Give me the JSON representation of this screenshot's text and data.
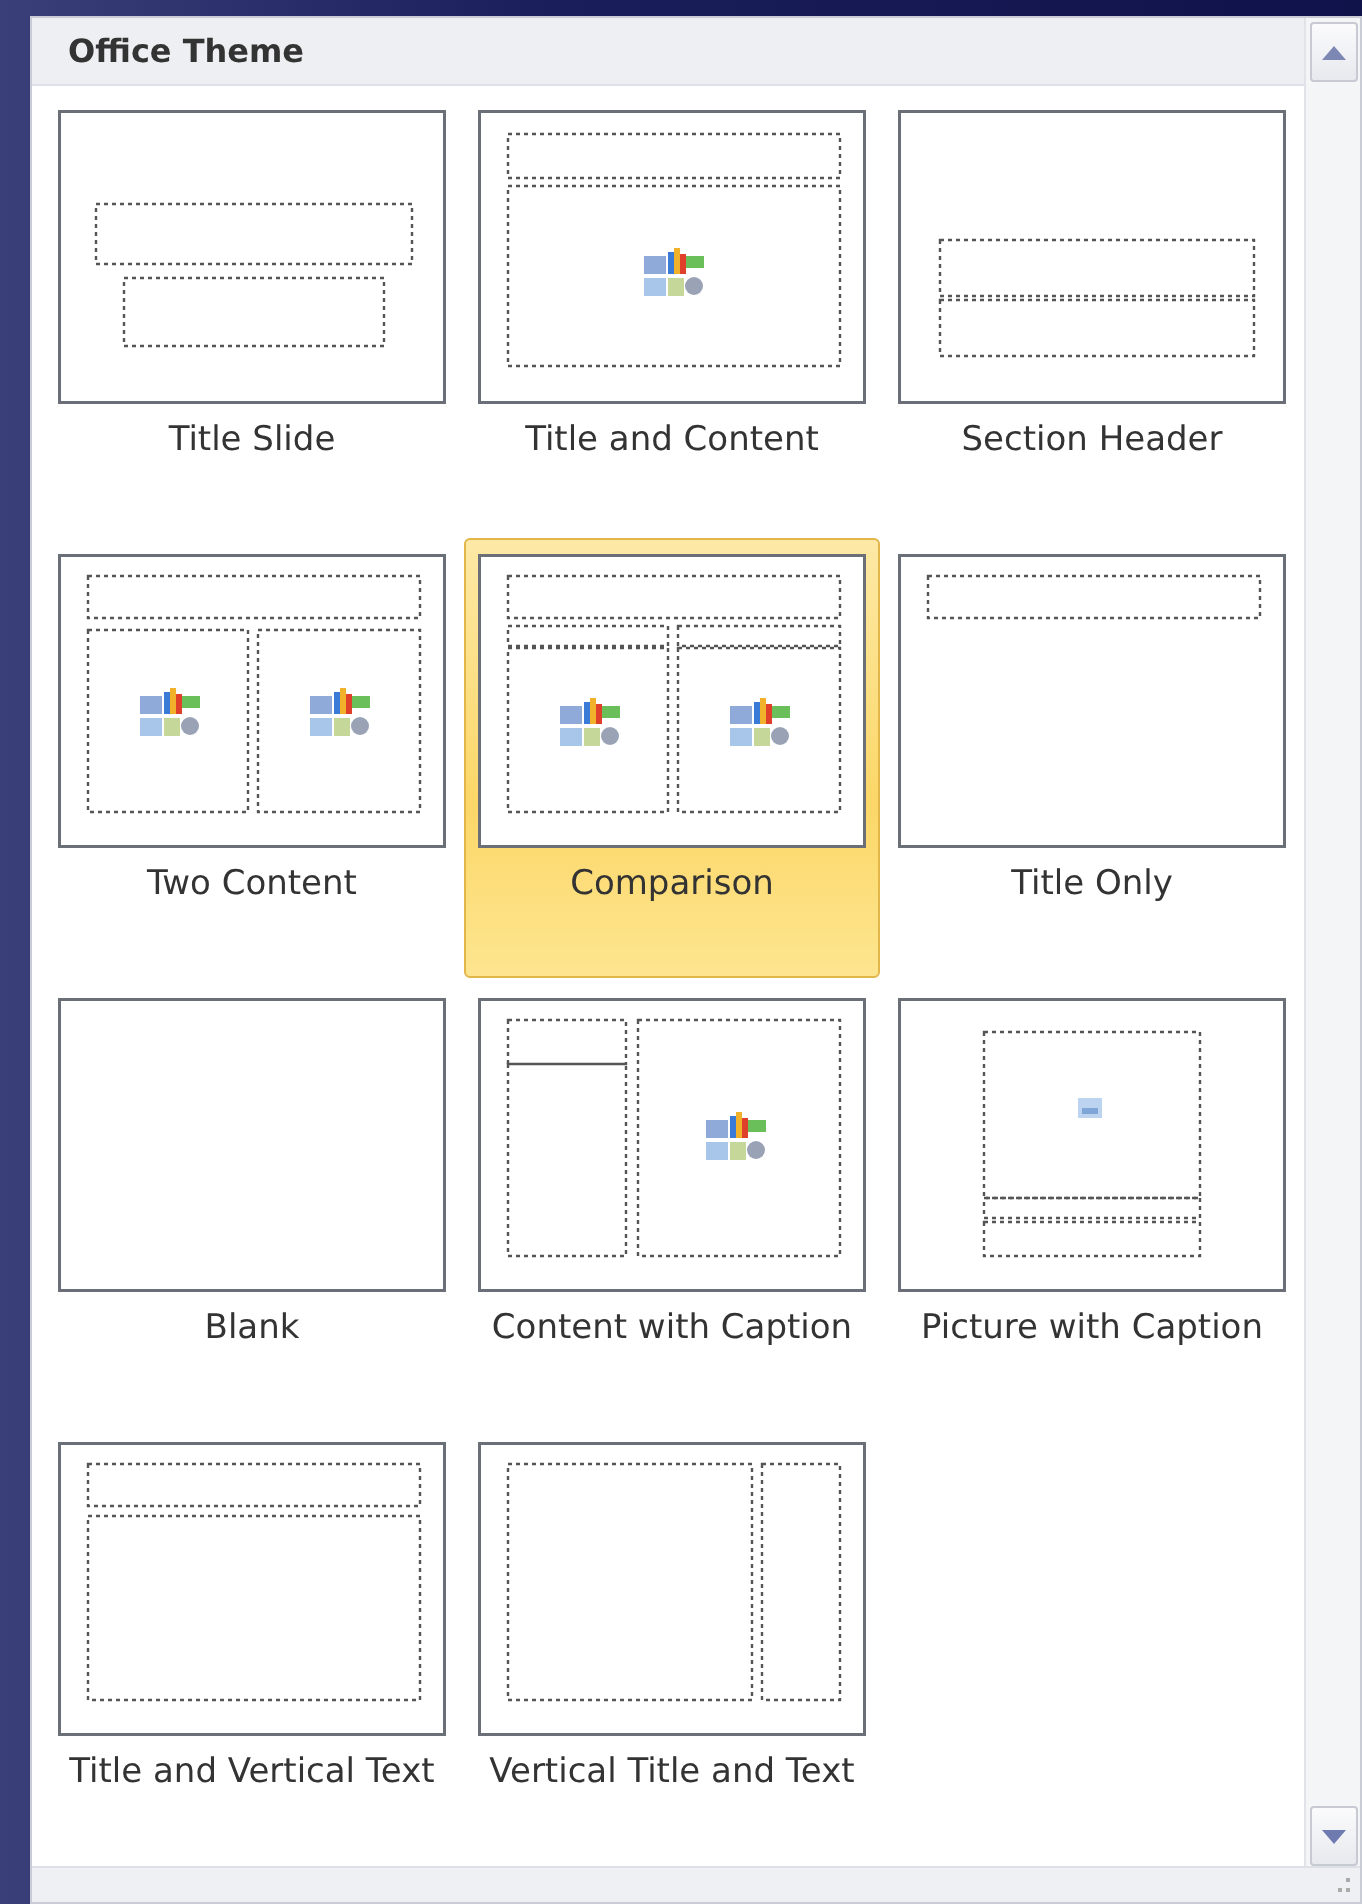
{
  "gallery": {
    "title": "Office Theme",
    "layouts": [
      {
        "label": "Title Slide",
        "kind": "title",
        "selected": false
      },
      {
        "label": "Title and Content",
        "kind": "title_content",
        "selected": false
      },
      {
        "label": "Section Header",
        "kind": "section_header",
        "selected": false
      },
      {
        "label": "Two Content",
        "kind": "two_content",
        "selected": false
      },
      {
        "label": "Comparison",
        "kind": "comparison",
        "selected": true
      },
      {
        "label": "Title Only",
        "kind": "title_only",
        "selected": false
      },
      {
        "label": "Blank",
        "kind": "blank",
        "selected": false
      },
      {
        "label": "Content with Caption",
        "kind": "content_caption",
        "selected": false
      },
      {
        "label": "Picture with Caption",
        "kind": "picture_caption",
        "selected": false
      },
      {
        "label": "Title and Vertical Text",
        "kind": "title_vertical_text",
        "selected": false
      },
      {
        "label": "Vertical Title and Text",
        "kind": "vertical_title_text",
        "selected": false
      }
    ]
  }
}
